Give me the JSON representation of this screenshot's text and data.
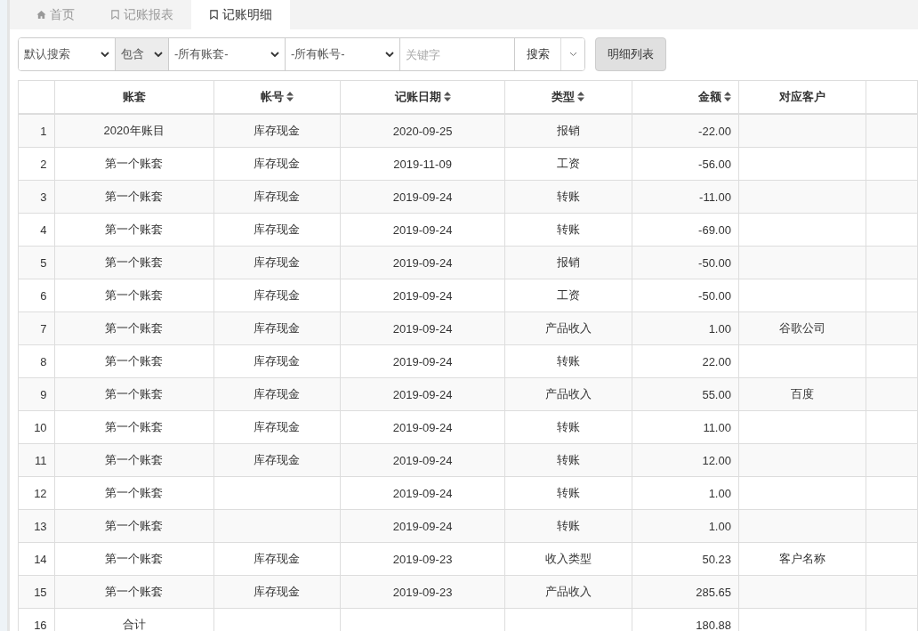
{
  "tabs": [
    {
      "label": "首页",
      "selected": false
    },
    {
      "label": "记账报表",
      "selected": false
    },
    {
      "label": "记账明细",
      "selected": true
    }
  ],
  "toolbar": {
    "selects": [
      {
        "value": "默认搜索",
        "shaded": false
      },
      {
        "value": "包含",
        "shaded": true
      },
      {
        "value": "-所有账套-",
        "shaded": false
      },
      {
        "value": "-所有帐号-",
        "shaded": false
      }
    ],
    "keyword": {
      "placeholder": "关键字"
    },
    "search_button": "搜索",
    "view_button": "明细列表"
  },
  "table": {
    "columns": [
      {
        "sortable": false
      },
      {
        "label": "账套",
        "sortable": false
      },
      {
        "label": "帐号",
        "sortable": true
      },
      {
        "label": "记账日期",
        "sortable": true
      },
      {
        "label": "类型",
        "sortable": true
      },
      {
        "label": "金额",
        "sortable": true
      },
      {
        "label": "对应客户",
        "sortable": false
      },
      {
        "sortable": false
      }
    ],
    "rows": [
      [
        "1",
        "2020年账目",
        "库存现金",
        "2020-09-25",
        "报销",
        "-22.00",
        "",
        ""
      ],
      [
        "2",
        "第一个账套",
        "库存现金",
        "2019-11-09",
        "工资",
        "-56.00",
        "",
        ""
      ],
      [
        "3",
        "第一个账套",
        "库存现金",
        "2019-09-24",
        "转账",
        "-11.00",
        "",
        ""
      ],
      [
        "4",
        "第一个账套",
        "库存现金",
        "2019-09-24",
        "转账",
        "-69.00",
        "",
        ""
      ],
      [
        "5",
        "第一个账套",
        "库存现金",
        "2019-09-24",
        "报销",
        "-50.00",
        "",
        ""
      ],
      [
        "6",
        "第一个账套",
        "库存现金",
        "2019-09-24",
        "工资",
        "-50.00",
        "",
        ""
      ],
      [
        "7",
        "第一个账套",
        "库存现金",
        "2019-09-24",
        "产品收入",
        "1.00",
        "谷歌公司",
        ""
      ],
      [
        "8",
        "第一个账套",
        "库存现金",
        "2019-09-24",
        "转账",
        "22.00",
        "",
        ""
      ],
      [
        "9",
        "第一个账套",
        "库存现金",
        "2019-09-24",
        "产品收入",
        "55.00",
        "百度",
        ""
      ],
      [
        "10",
        "第一个账套",
        "库存现金",
        "2019-09-24",
        "转账",
        "11.00",
        "",
        ""
      ],
      [
        "11",
        "第一个账套",
        "库存现金",
        "2019-09-24",
        "转账",
        "12.00",
        "",
        ""
      ],
      [
        "12",
        "第一个账套",
        "",
        "2019-09-24",
        "转账",
        "1.00",
        "",
        ""
      ],
      [
        "13",
        "第一个账套",
        "",
        "2019-09-24",
        "转账",
        "1.00",
        "",
        ""
      ],
      [
        "14",
        "第一个账套",
        "库存现金",
        "2019-09-23",
        "收入类型",
        "50.23",
        "客户名称",
        ""
      ],
      [
        "15",
        "第一个账套",
        "库存现金",
        "2019-09-23",
        "产品收入",
        "285.65",
        "",
        ""
      ],
      [
        "16",
        "合计",
        "",
        "",
        "",
        "180.88",
        "",
        ""
      ]
    ]
  }
}
